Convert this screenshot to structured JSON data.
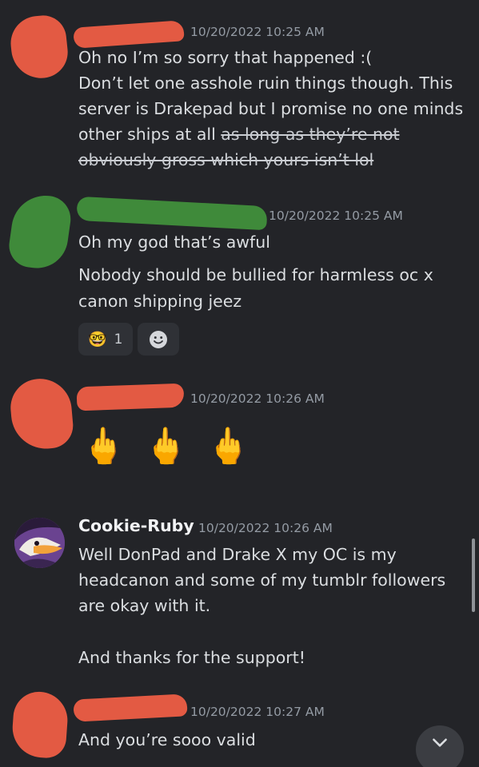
{
  "messages": [
    {
      "timestamp": "10/20/2022 10:25 AM",
      "lines": [
        "Oh no I’m so sorry that happened :(",
        "Don’t let one asshole ruin things though. This",
        "server is Drakepad but I promise no one minds",
        "other ships at all "
      ],
      "strike_part1": "as long as they’re not",
      "strike_part2": "obviously gross which yours isn’t lol"
    },
    {
      "timestamp": "10/20/2022 10:25 AM",
      "lines": [
        "Oh my god that’s awful",
        "Nobody should be bullied for harmless oc x",
        "canon shipping jeez"
      ],
      "reaction": {
        "emoji": "🤓",
        "count": "1"
      },
      "add_reaction_icon": "smiley-icon"
    },
    {
      "timestamp": "10/20/2022 10:26 AM",
      "emoji_line": [
        "🖕",
        "🖕",
        "🖕"
      ]
    },
    {
      "username": "Cookie-Ruby",
      "timestamp": "10/20/2022 10:26 AM",
      "lines": [
        "Well DonPad and  Drake X my OC is my",
        "headcanon and some of my tumblr followers",
        "are okay with it.",
        "And thanks for the support!"
      ]
    },
    {
      "timestamp": "10/20/2022 10:27 AM",
      "lines": [
        "And you’re sooo valid"
      ]
    }
  ],
  "jump_button_icon": "chevron-down-icon",
  "colors": {
    "background": "#232428",
    "text": "#dbdee1",
    "timestamp": "#949ba4",
    "redact_red": "#e35a43",
    "redact_green": "#3f8a3a"
  }
}
